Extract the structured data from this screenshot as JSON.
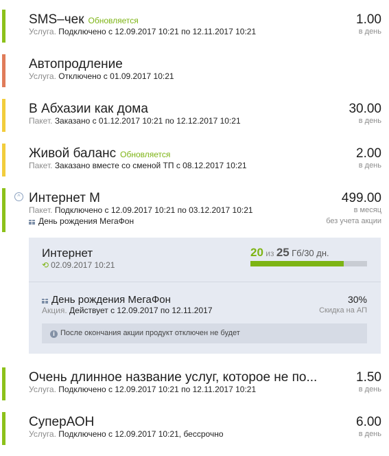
{
  "colors": {
    "active": "#8cc11a",
    "disabled": "#e07c5a",
    "pending": "#f2cd3c",
    "accent_green": "#7db414"
  },
  "items": [
    {
      "title": "SMS–чек",
      "badge": "Обновляется",
      "kind": "Услуга.",
      "status": "Подключено с 12.09.2017 10:21 по 12.11.2017 10:21",
      "price": "1.00",
      "unit": "в день",
      "bar": "active"
    },
    {
      "title": "Автопродление",
      "kind": "Услуга.",
      "status": "Отключено с 01.09.2017 10:21",
      "bar": "disabled"
    },
    {
      "title": "В Абхазии как дома",
      "kind": "Пакет.",
      "status": "Заказано с 01.12.2017 10:21 по 12.12.2017 10:21",
      "price": "30.00",
      "unit": "в день",
      "bar": "pending"
    },
    {
      "title": "Живой баланс",
      "badge": "Обновляется",
      "kind": "Пакет.",
      "status": "Заказано вместе со сменой ТП с 08.12.2017 10:21",
      "price": "2.00",
      "unit": "в день",
      "bar": "pending"
    },
    {
      "title": "Интернет М",
      "kind": "Пакет.",
      "status": "Подключено с 12.09.2017 10:21 по 03.12.2017 10:21",
      "promo_line": "День рождения МегаФон",
      "price": "499.00",
      "unit": "в месяц",
      "unit2": "без учета акции",
      "bar": "active",
      "expand_icon": "chevron-up-icon"
    },
    {
      "title": "Очень длинное название услуг, которое не по...",
      "kind": "Услуга.",
      "status": "Подключено с 12.09.2017 10:21 по 12.11.2017 10:21",
      "price": "1.50",
      "unit": "в день",
      "bar": "active"
    },
    {
      "title": "СуперАОН",
      "kind": "Услуга.",
      "status": "Подключено с 12.09.2017 10:21, бессрочно",
      "price": "6.00",
      "unit": "в день",
      "bar": "active"
    }
  ],
  "details": {
    "title": "Интернет",
    "date": "02.09.2017 10:21",
    "quota_used": "20",
    "quota_of": "из",
    "quota_total": "25",
    "quota_unit": "Гб/30 дн.",
    "progress_fraction": 0.8,
    "promo": {
      "title": "День рождения МегаФон",
      "kind": "Акция.",
      "status": "Действует с 12.09.2017 по 12.11.2017",
      "value": "30%",
      "value_label": "Скидка на АП"
    },
    "notice": "После окончания акции продукт отключен не будет"
  }
}
